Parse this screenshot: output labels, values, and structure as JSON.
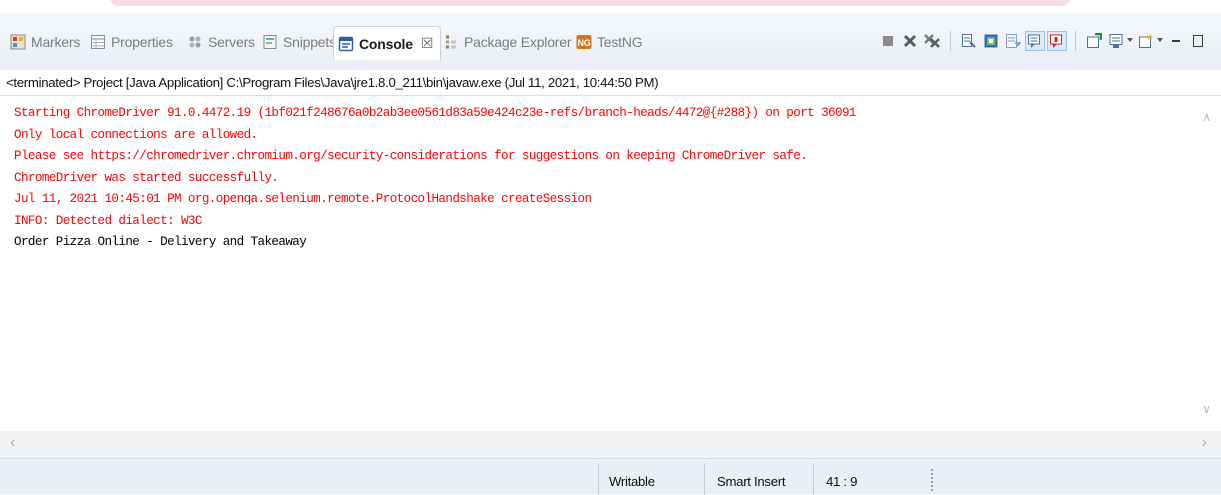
{
  "tabs": [
    {
      "label": "Markers",
      "icon": "markers-icon",
      "active": false
    },
    {
      "label": "Properties",
      "icon": "properties-icon",
      "active": false
    },
    {
      "label": "Servers",
      "icon": "servers-icon",
      "active": false
    },
    {
      "label": "Snippets",
      "icon": "snippets-icon",
      "active": false
    },
    {
      "label": "Console",
      "icon": "console-icon",
      "active": true,
      "close": "☒"
    },
    {
      "label": "Package Explorer",
      "icon": "package-explorer-icon",
      "active": false
    },
    {
      "label": "TestNG",
      "icon": "testng-icon",
      "active": false
    }
  ],
  "toolbar": {
    "icons": [
      "terminate-icon",
      "remove-launch-icon",
      "remove-all-terminated-icon",
      "clear-console-icon",
      "scroll-lock-icon",
      "word-wrap-icon",
      "show-on-stdout-icon",
      "show-on-stderr-icon",
      "pin-console-icon",
      "display-selected-console-icon",
      "open-console-icon",
      "minimize-icon",
      "maximize-icon"
    ]
  },
  "console": {
    "header": "<terminated> Project [Java Application] C:\\Program Files\\Java\\jre1.8.0_211\\bin\\javaw.exe  (Jul 11, 2021, 10:44:50 PM)",
    "lines": [
      {
        "text": "Starting ChromeDriver 91.0.4472.19 (1bf021f248676a0b2ab3ee0561d83a59e424c23e-refs/branch-heads/4472@{#288}) on port 36091",
        "stream": "stderr"
      },
      {
        "text": "Only local connections are allowed.",
        "stream": "stderr"
      },
      {
        "text": "Please see https://chromedriver.chromium.org/security-considerations for suggestions on keeping ChromeDriver safe.",
        "stream": "stderr"
      },
      {
        "text": "ChromeDriver was started successfully.",
        "stream": "stderr"
      },
      {
        "text": "Jul 11, 2021 10:45:01 PM org.openqa.selenium.remote.ProtocolHandshake createSession",
        "stream": "stderr"
      },
      {
        "text": "INFO: Detected dialect: W3C",
        "stream": "stderr"
      },
      {
        "text": "Order Pizza Online - Delivery and Takeaway",
        "stream": "stdout"
      }
    ],
    "scroll": {
      "up": "∧",
      "down": "∨",
      "left": "‹",
      "right": "›"
    }
  },
  "status": {
    "writable": "Writable",
    "insert_mode": "Smart Insert",
    "position": "41 : 9"
  },
  "colors": {
    "stderr": "#ff0000",
    "stdout": "#000000",
    "accent": "#2f6fc4"
  }
}
